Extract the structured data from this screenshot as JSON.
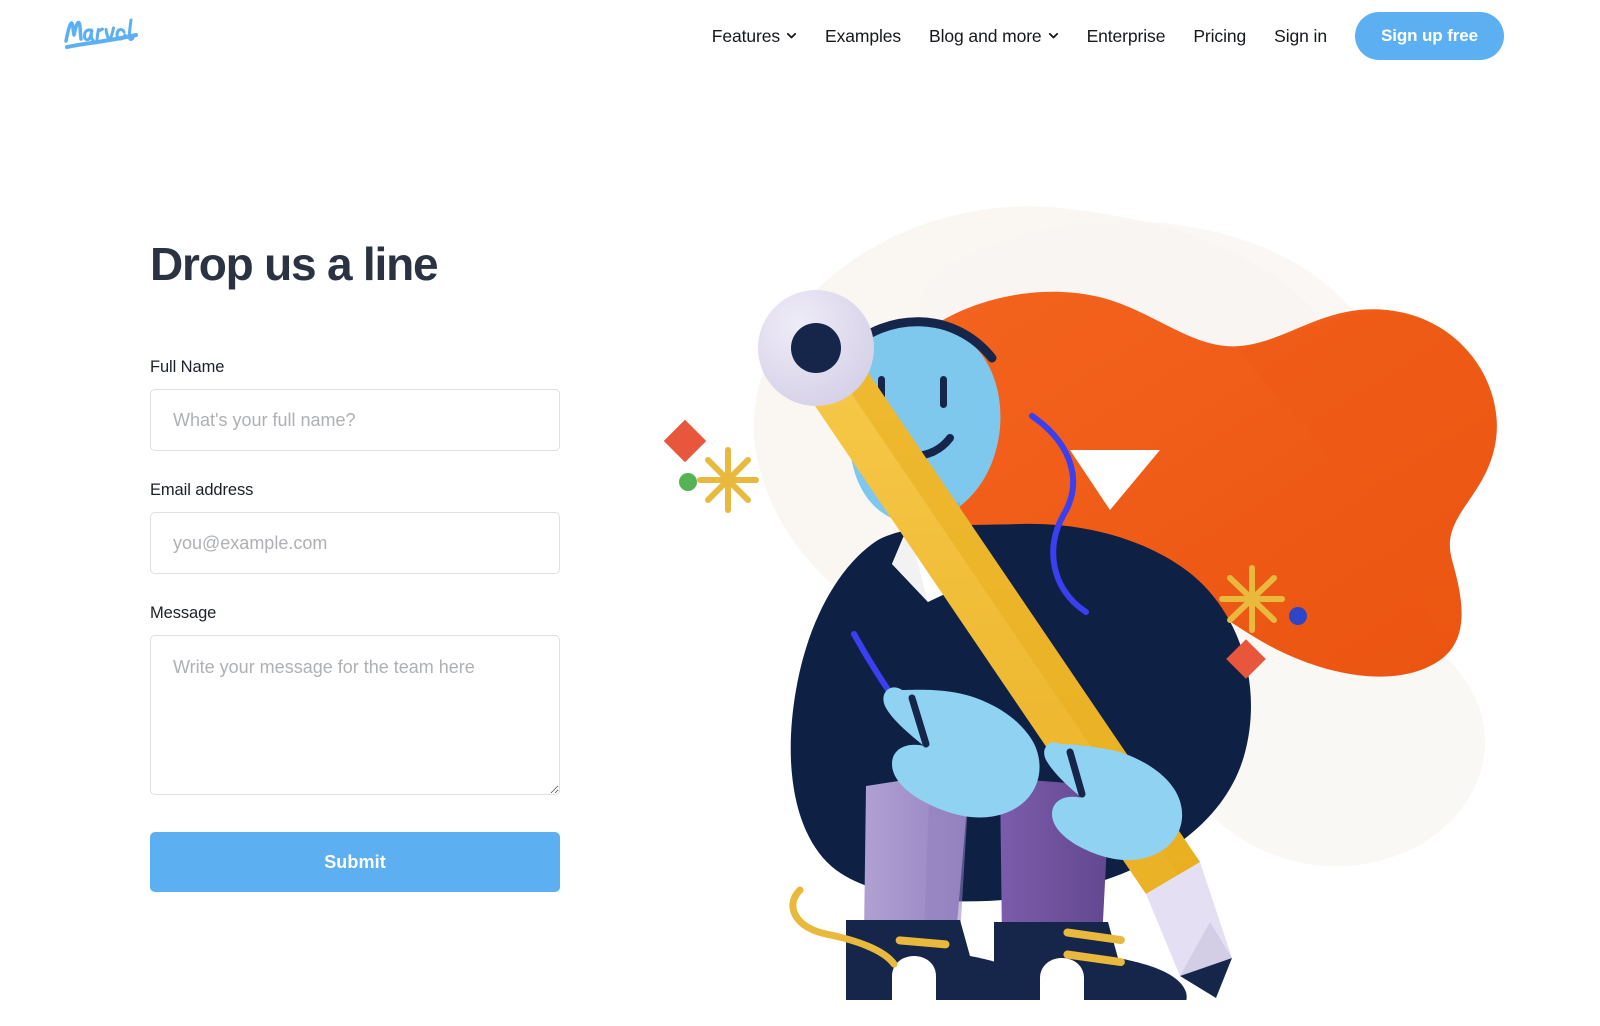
{
  "header": {
    "logo": {
      "name": "Marvel",
      "icon": "marvel-wordmark-logo",
      "color": "#5cb0f2"
    },
    "nav_items": [
      {
        "label": "Features",
        "has_dropdown": true,
        "icon": "chevron-down-icon"
      },
      {
        "label": "Examples",
        "has_dropdown": false,
        "icon": ""
      },
      {
        "label": "Blog and more",
        "has_dropdown": true,
        "icon": "chevron-down-icon"
      },
      {
        "label": "Enterprise",
        "has_dropdown": false,
        "icon": ""
      },
      {
        "label": "Pricing",
        "has_dropdown": false,
        "icon": ""
      },
      {
        "label": "Sign in",
        "has_dropdown": false,
        "icon": ""
      }
    ],
    "signup_button": {
      "label": "Sign up free",
      "background": "#5cb0f2",
      "text_color": "#ffffff"
    }
  },
  "main": {
    "title": "Drop us a line",
    "title_color": "#2b3342",
    "form": {
      "fields": [
        {
          "label": "Full Name",
          "placeholder": "What's your full name?",
          "value": "",
          "type": "text"
        },
        {
          "label": "Email address",
          "placeholder": "you@example.com",
          "value": "",
          "type": "email"
        },
        {
          "label": "Message",
          "placeholder": "Write your message for the team here",
          "value": "",
          "type": "textarea"
        }
      ],
      "submit_button": {
        "label": "Submit",
        "background": "#5cb0f2",
        "text_color": "#ffffff"
      },
      "border_color": "#dfdfdf",
      "placeholder_color": "#aeb0b4"
    }
  },
  "illustration": {
    "name": "person-holding-giant-pencil-illustration",
    "colors": {
      "hair_orange": "#f4601d",
      "hair_orange_dark": "#e8530f",
      "skin_blue": "#7ec8ee",
      "skin_blue_light": "#8fd2f2",
      "jacket_navy": "#0e2044",
      "jacket_line_blue": "#3a3ff0",
      "pencil_yellow": "#f5c13d",
      "pencil_yellow_dark": "#edb324",
      "eraser_lavender": "#ddd9ee",
      "graphite_navy": "#16254a",
      "leg_purple_light": "#a592cc",
      "leg_purple_dark": "#6b4f9e",
      "shoe_navy": "#16254a",
      "lace_yellow": "#e8b93c",
      "accent_red": "#e8563c",
      "accent_green": "#55b255",
      "accent_blue_dot": "#2d45c8",
      "accent_star_yellow": "#e8b93c",
      "blob_cream": "#faf7f2",
      "ground_gray": "#e6e8ef"
    }
  }
}
